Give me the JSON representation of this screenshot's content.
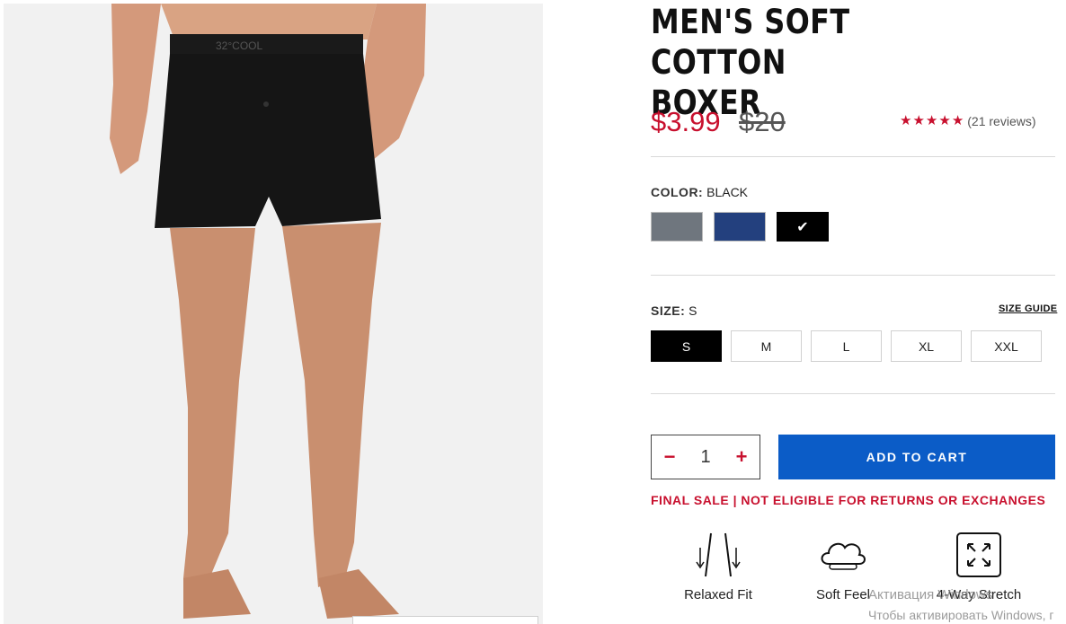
{
  "product": {
    "title": "MEN'S SOFT COTTON\nBOXER",
    "sale_price": "$3.99",
    "original_price": "$20",
    "rating_stars": 5,
    "review_count": "(21 reviews)",
    "brand_waistband": "32°COOL"
  },
  "color": {
    "label": "COLOR:",
    "selected": "BLACK",
    "swatches": [
      {
        "name": "gray",
        "hex": "#6f767e",
        "selected": false
      },
      {
        "name": "navy",
        "hex": "#23407e",
        "selected": false
      },
      {
        "name": "black",
        "hex": "#000000",
        "selected": true
      }
    ]
  },
  "size": {
    "label": "SIZE:",
    "selected": "S",
    "guide_label": "SIZE GUIDE",
    "options": [
      "S",
      "M",
      "L",
      "XL",
      "XXL"
    ]
  },
  "cart": {
    "quantity": "1",
    "minus": "−",
    "plus": "+",
    "add_label": "ADD TO CART"
  },
  "final_sale_notice": "FINAL SALE | NOT ELIGIBLE FOR RETURNS OR EXCHANGES",
  "features": [
    {
      "label": "Relaxed Fit",
      "icon": "relaxed-fit-icon"
    },
    {
      "label": "Soft Feel",
      "icon": "cloud-icon"
    },
    {
      "label": "4-Way Stretch",
      "icon": "stretch-arrows-icon"
    }
  ],
  "os_watermark": {
    "line1": "Активация Windows",
    "line2": "Чтобы активировать Windows, г"
  },
  "colors": {
    "accent_red": "#c8102e",
    "cta_blue": "#0b5cc7"
  }
}
